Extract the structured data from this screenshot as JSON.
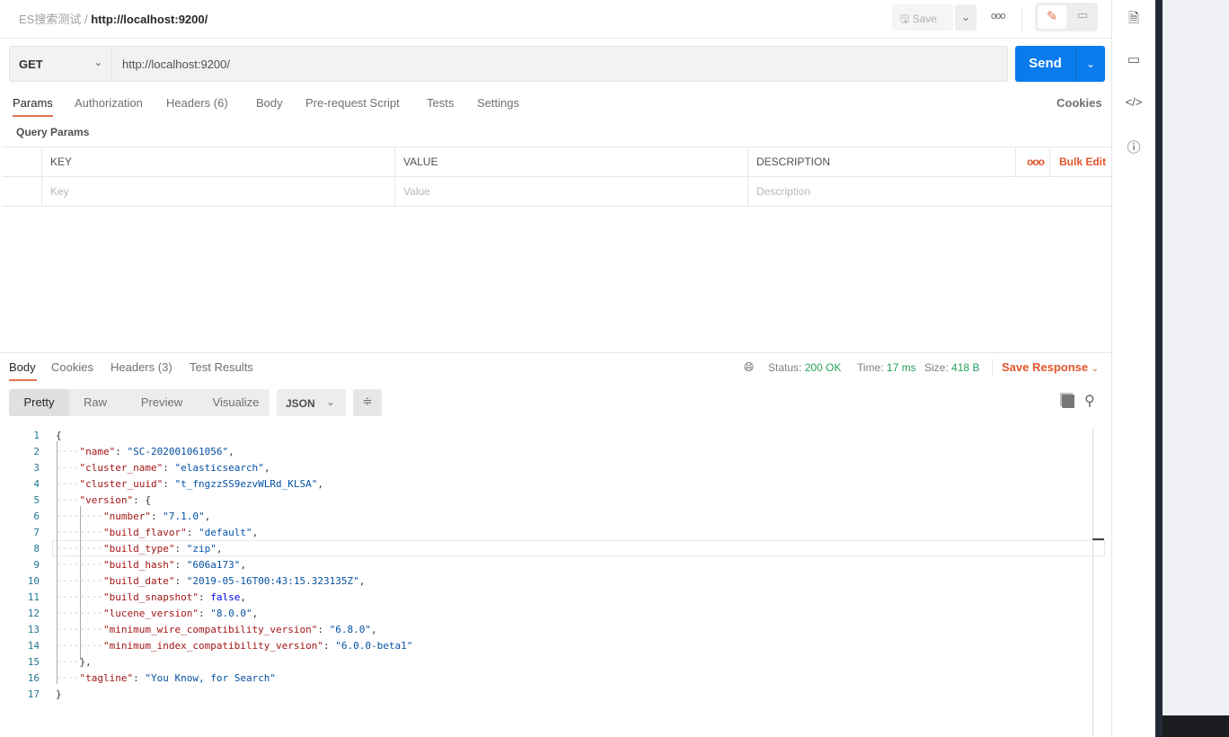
{
  "header": {
    "collection": "ES搜索测试",
    "separator": "/",
    "request_name": "http://localhost:9200/",
    "save_label": "Save"
  },
  "request": {
    "method": "GET",
    "url": "http://localhost:9200/",
    "send_label": "Send"
  },
  "request_tabs": [
    {
      "label": "Params"
    },
    {
      "label": "Authorization"
    },
    {
      "label": "Headers",
      "count": "(6)"
    },
    {
      "label": "Body"
    },
    {
      "label": "Pre-request Script"
    },
    {
      "label": "Tests"
    },
    {
      "label": "Settings"
    }
  ],
  "cookies_label": "Cookies",
  "query_params": {
    "title": "Query Params",
    "columns": [
      "KEY",
      "VALUE",
      "DESCRIPTION"
    ],
    "bulk_edit": "Bulk Edit",
    "placeholders": [
      "Key",
      "Value",
      "Description"
    ]
  },
  "response_tabs": [
    {
      "label": "Body"
    },
    {
      "label": "Cookies"
    },
    {
      "label": "Headers",
      "count": "(3)"
    },
    {
      "label": "Test Results"
    }
  ],
  "response_status": {
    "status_label": "Status:",
    "status": "200 OK",
    "time_label": "Time:",
    "time": "17 ms",
    "size_label": "Size:",
    "size": "418 B",
    "save_response": "Save Response"
  },
  "view_modes": [
    "Pretty",
    "Raw",
    "Preview",
    "Visualize"
  ],
  "format": "JSON",
  "colors": {
    "accent": "#e4744b",
    "send": "#097bed",
    "success": "#26a05e"
  },
  "code_lines": [
    [
      [
        "p",
        "{"
      ]
    ],
    [
      [
        "w",
        "····"
      ],
      [
        "k",
        "\"name\""
      ],
      [
        "p",
        ": "
      ],
      [
        "s",
        "\"SC-202001061056\""
      ],
      [
        "p",
        ","
      ]
    ],
    [
      [
        "w",
        "····"
      ],
      [
        "k",
        "\"cluster_name\""
      ],
      [
        "p",
        ": "
      ],
      [
        "s",
        "\"elasticsearch\""
      ],
      [
        "p",
        ","
      ]
    ],
    [
      [
        "w",
        "····"
      ],
      [
        "k",
        "\"cluster_uuid\""
      ],
      [
        "p",
        ": "
      ],
      [
        "s",
        "\"t_fngzzSS9ezvWLRd_KLSA\""
      ],
      [
        "p",
        ","
      ]
    ],
    [
      [
        "w",
        "····"
      ],
      [
        "k",
        "\"version\""
      ],
      [
        "p",
        ": {"
      ]
    ],
    [
      [
        "w",
        "········"
      ],
      [
        "k",
        "\"number\""
      ],
      [
        "p",
        ": "
      ],
      [
        "s",
        "\"7.1.0\""
      ],
      [
        "p",
        ","
      ]
    ],
    [
      [
        "w",
        "········"
      ],
      [
        "k",
        "\"build_flavor\""
      ],
      [
        "p",
        ": "
      ],
      [
        "s",
        "\"default\""
      ],
      [
        "p",
        ","
      ]
    ],
    [
      [
        "w",
        "········"
      ],
      [
        "k",
        "\"build_type\""
      ],
      [
        "p",
        ": "
      ],
      [
        "s",
        "\"zip\""
      ],
      [
        "p",
        ","
      ]
    ],
    [
      [
        "w",
        "········"
      ],
      [
        "k",
        "\"build_hash\""
      ],
      [
        "p",
        ": "
      ],
      [
        "s",
        "\"606a173\""
      ],
      [
        "p",
        ","
      ]
    ],
    [
      [
        "w",
        "········"
      ],
      [
        "k",
        "\"build_date\""
      ],
      [
        "p",
        ": "
      ],
      [
        "s",
        "\"2019-05-16T00:43:15.323135Z\""
      ],
      [
        "p",
        ","
      ]
    ],
    [
      [
        "w",
        "········"
      ],
      [
        "k",
        "\"build_snapshot\""
      ],
      [
        "p",
        ": "
      ],
      [
        "b",
        "false"
      ],
      [
        "p",
        ","
      ]
    ],
    [
      [
        "w",
        "········"
      ],
      [
        "k",
        "\"lucene_version\""
      ],
      [
        "p",
        ": "
      ],
      [
        "s",
        "\"8.0.0\""
      ],
      [
        "p",
        ","
      ]
    ],
    [
      [
        "w",
        "········"
      ],
      [
        "k",
        "\"minimum_wire_compatibility_version\""
      ],
      [
        "p",
        ": "
      ],
      [
        "s",
        "\"6.8.0\""
      ],
      [
        "p",
        ","
      ]
    ],
    [
      [
        "w",
        "········"
      ],
      [
        "k",
        "\"minimum_index_compatibility_version\""
      ],
      [
        "p",
        ": "
      ],
      [
        "s",
        "\"6.0.0-beta1\""
      ]
    ],
    [
      [
        "w",
        "····"
      ],
      [
        "p",
        "},"
      ]
    ],
    [
      [
        "w",
        "····"
      ],
      [
        "k",
        "\"tagline\""
      ],
      [
        "p",
        ": "
      ],
      [
        "s",
        "\"You Know, for Search\""
      ]
    ],
    [
      [
        "p",
        "}"
      ]
    ]
  ]
}
